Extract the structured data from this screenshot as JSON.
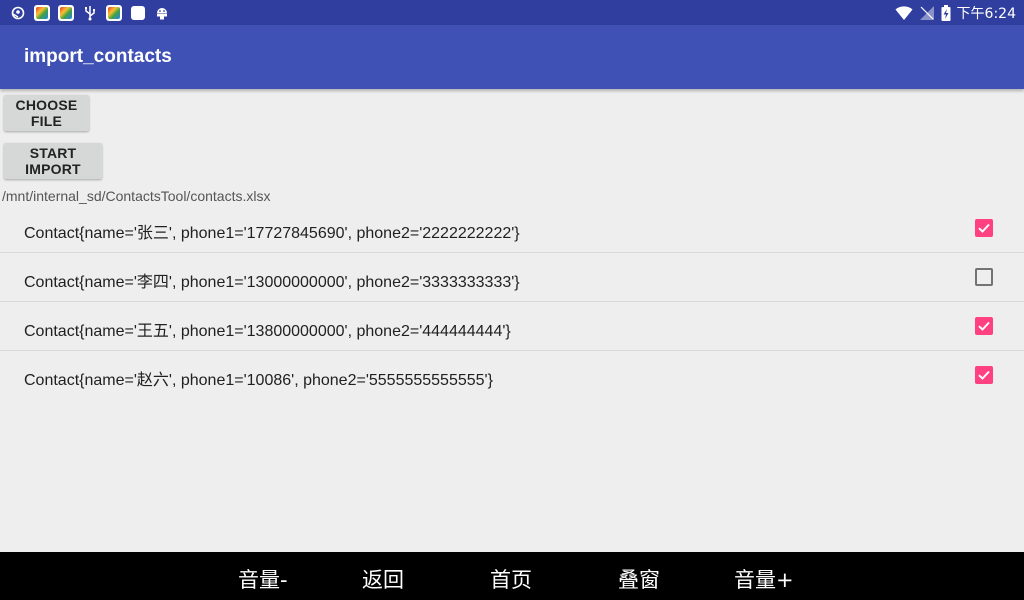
{
  "status_bar": {
    "time": "下午6:24",
    "left_icons": [
      "steam-icon",
      "app-icon",
      "app-icon",
      "usb-icon",
      "app-icon",
      "blank-square-icon",
      "android-debug-icon"
    ],
    "right_icons": [
      "wifi-icon",
      "signal-icon",
      "battery-charging-icon"
    ]
  },
  "app_bar": {
    "title": "import_contacts"
  },
  "buttons": {
    "choose_file": "CHOOSE FILE",
    "start_import": "START IMPORT"
  },
  "file_path": "/mnt/internal_sd/ContactsTool/contacts.xlsx",
  "contacts": [
    {
      "text": "Contact{name='张三', phone1='17727845690', phone2='2222222222'}",
      "checked": true
    },
    {
      "text": "Contact{name='李四', phone1='13000000000', phone2='3333333333'}",
      "checked": false
    },
    {
      "text": "Contact{name='王五', phone1='13800000000', phone2='444444444'}",
      "checked": true
    },
    {
      "text": "Contact{name='赵六', phone1='10086', phone2='5555555555555'}",
      "checked": true
    }
  ],
  "nav_bar": {
    "volume_down": "音量-",
    "back": "返回",
    "home": "首页",
    "multi_window": "叠窗",
    "volume_up": "音量+"
  },
  "colors": {
    "status_bar": "#303f9f",
    "app_bar": "#3f51b5",
    "accent": "#ff4081",
    "background": "#eeeeee"
  }
}
